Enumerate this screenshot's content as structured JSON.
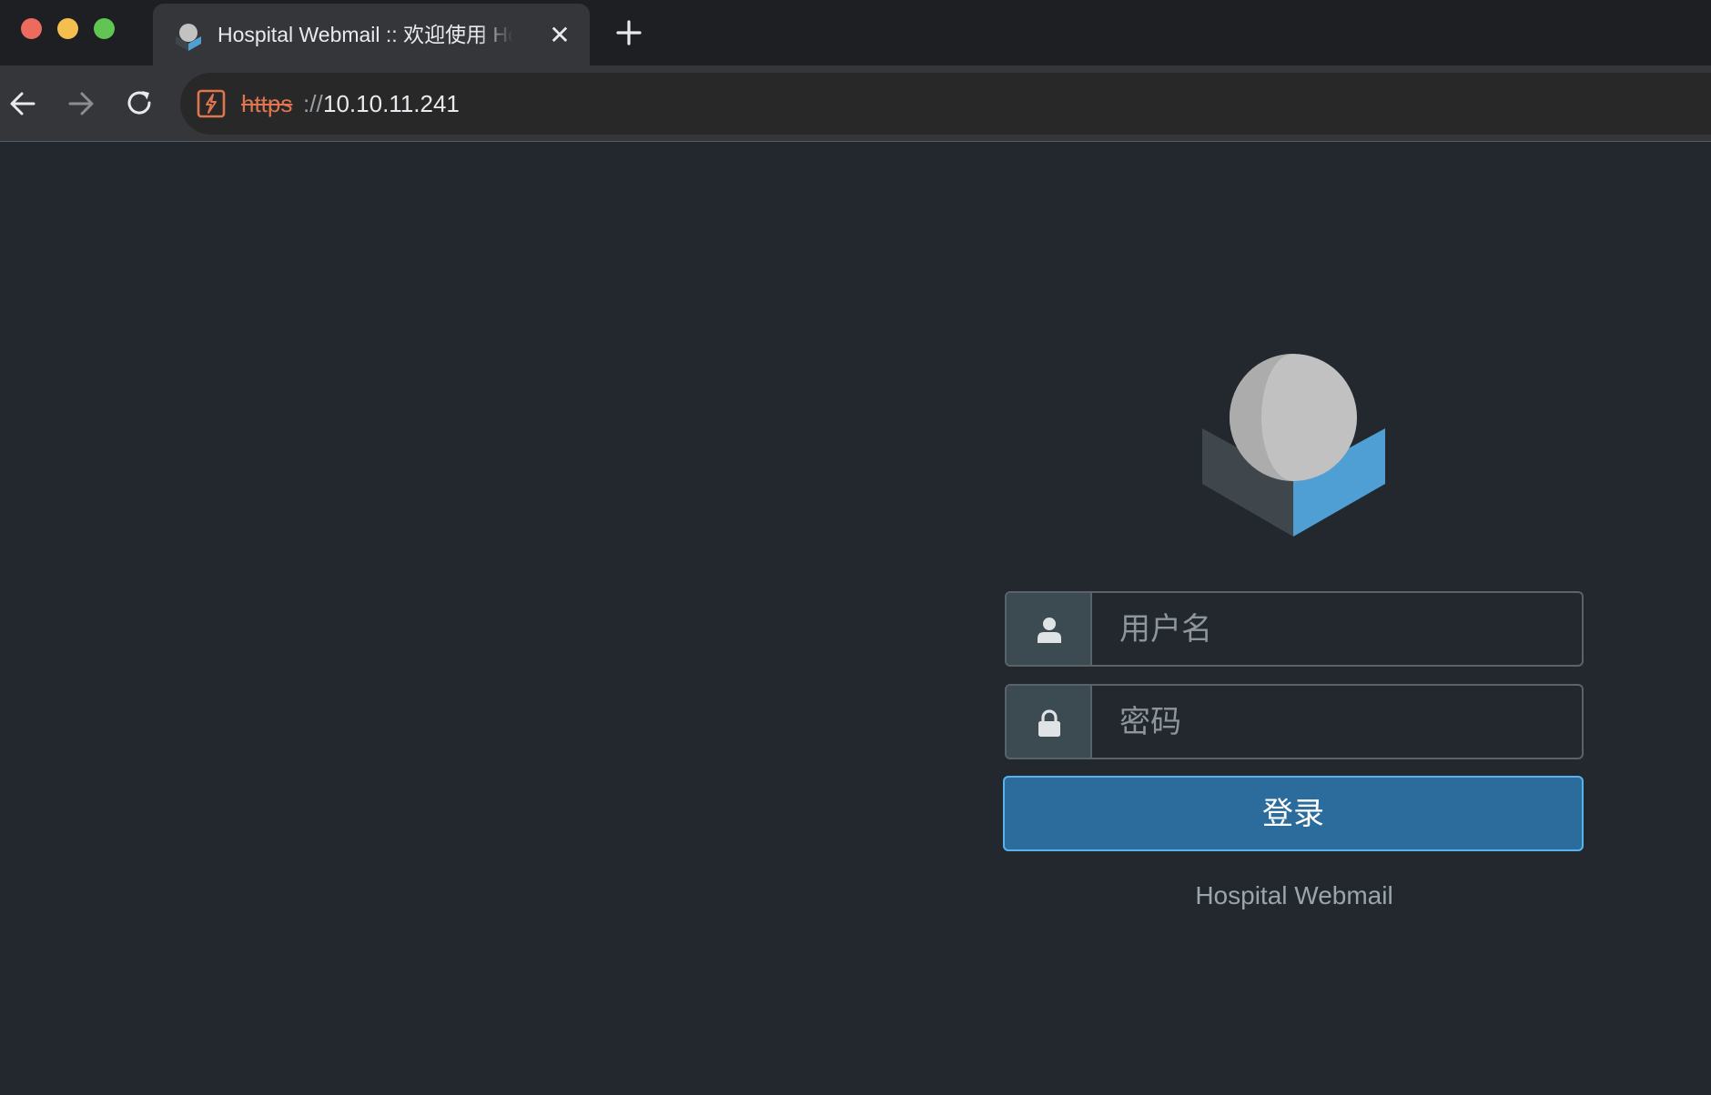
{
  "browser": {
    "tab": {
      "title": "Hospital Webmail :: 欢迎使用 Ho",
      "close_symbol": "✕",
      "favicon": "roundcube-logo-icon"
    },
    "new_tab": "plus-icon",
    "nav": {
      "back": "arrow-left-icon",
      "forward": "arrow-right-icon",
      "reload": "reload-icon"
    },
    "address_bar": {
      "security_icon": "not-secure-icon",
      "scheme": "https",
      "separator": "://",
      "host": "10.10.11.241"
    },
    "colors": {
      "not_secure": "#e0754f",
      "traffic_red": "#ed6a5e",
      "traffic_yellow": "#f5bf4f",
      "traffic_green": "#61c554"
    }
  },
  "login": {
    "logo": "roundcube-logo",
    "username": {
      "icon": "user-icon",
      "placeholder": "用户名",
      "value": ""
    },
    "password": {
      "icon": "lock-icon",
      "placeholder": "密码",
      "value": ""
    },
    "submit_label": "登录",
    "product_name": "Hospital Webmail",
    "colors": {
      "background": "#22282d",
      "button": "#2c6c9c",
      "button_border": "#58b3ec",
      "addon": "#3c4a51"
    }
  }
}
